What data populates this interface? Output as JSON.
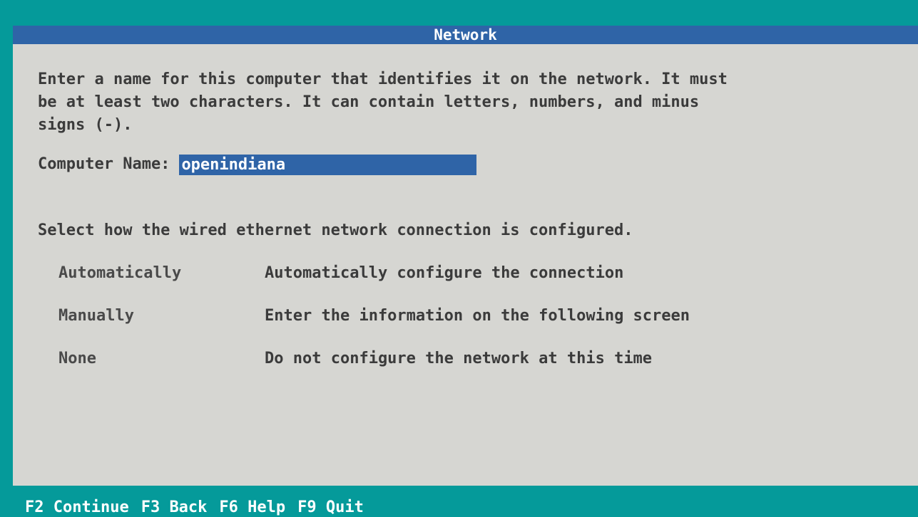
{
  "window": {
    "title": "Network"
  },
  "intro": {
    "lines": [
      "Enter a name for this computer that identifies it on the network. It must",
      "be at least two characters. It can contain letters, numbers, and minus",
      "signs (-)."
    ]
  },
  "computer_name": {
    "label": "Computer Name:",
    "value": "openindiana"
  },
  "network": {
    "prompt": "Select how the wired ethernet network connection is configured.",
    "options": [
      {
        "name": "Automatically",
        "description": "Automatically configure the connection"
      },
      {
        "name": "Manually",
        "description": "Enter the information on the following screen"
      },
      {
        "name": "None",
        "description": "Do not configure the network at this time"
      }
    ]
  },
  "footer": {
    "keys": [
      {
        "label": "F2 Continue"
      },
      {
        "label": "F3 Back"
      },
      {
        "label": "F6 Help"
      },
      {
        "label": "F9 Quit"
      }
    ]
  },
  "colors": {
    "desktop": "#059a9a",
    "panel": "#d6d6d2",
    "title_bar": "#2f64a7",
    "input_highlight": "#2f64a7"
  }
}
